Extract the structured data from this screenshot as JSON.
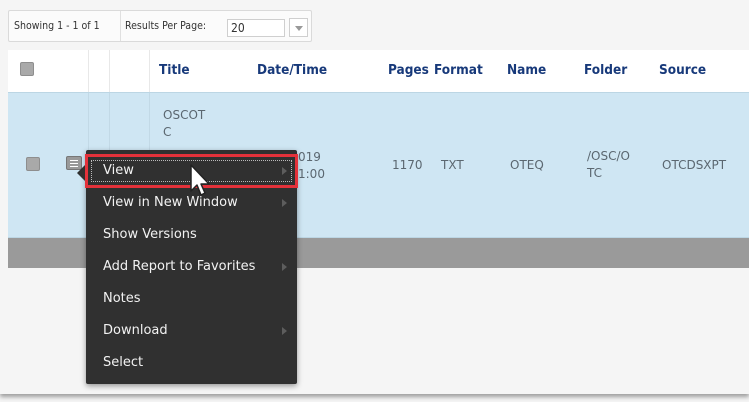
{
  "pager": {
    "showing": "Showing 1 - 1 of 1",
    "results_per_page_label": "Results Per Page:",
    "results_per_page_value": "20"
  },
  "table": {
    "headers": [
      "Title",
      "Date/Time",
      "Pages",
      "Format",
      "Name",
      "Folder",
      "Source"
    ],
    "row": {
      "title_lines": [
        "OSCOT",
        "C"
      ],
      "datetime_lines": [
        "019",
        "1:00"
      ],
      "pages": "1170",
      "format": "TXT",
      "name": "OTEQ",
      "folder_lines": [
        "/OSC/O",
        "TC"
      ],
      "source": "OTCDSXPT"
    }
  },
  "context_menu": {
    "items": [
      {
        "label": "View",
        "submenu": true,
        "highlighted": true
      },
      {
        "label": "View in New Window",
        "submenu": true
      },
      {
        "label": "Show Versions",
        "submenu": false
      },
      {
        "label": "Add Report to Favorites",
        "submenu": true
      },
      {
        "label": "Notes",
        "submenu": false
      },
      {
        "label": "Download",
        "submenu": true
      },
      {
        "label": "Select",
        "submenu": false
      }
    ]
  },
  "colors": {
    "header_text": "#17397a",
    "selected_row": "#cfe6f3",
    "menu_bg": "#303030",
    "highlight_outline": "#e3313a"
  },
  "icons": [
    "checkbox-icon",
    "row-actions-icon",
    "submenu-arrow-icon",
    "dropdown-arrow-icon",
    "mouse-cursor-icon"
  ]
}
